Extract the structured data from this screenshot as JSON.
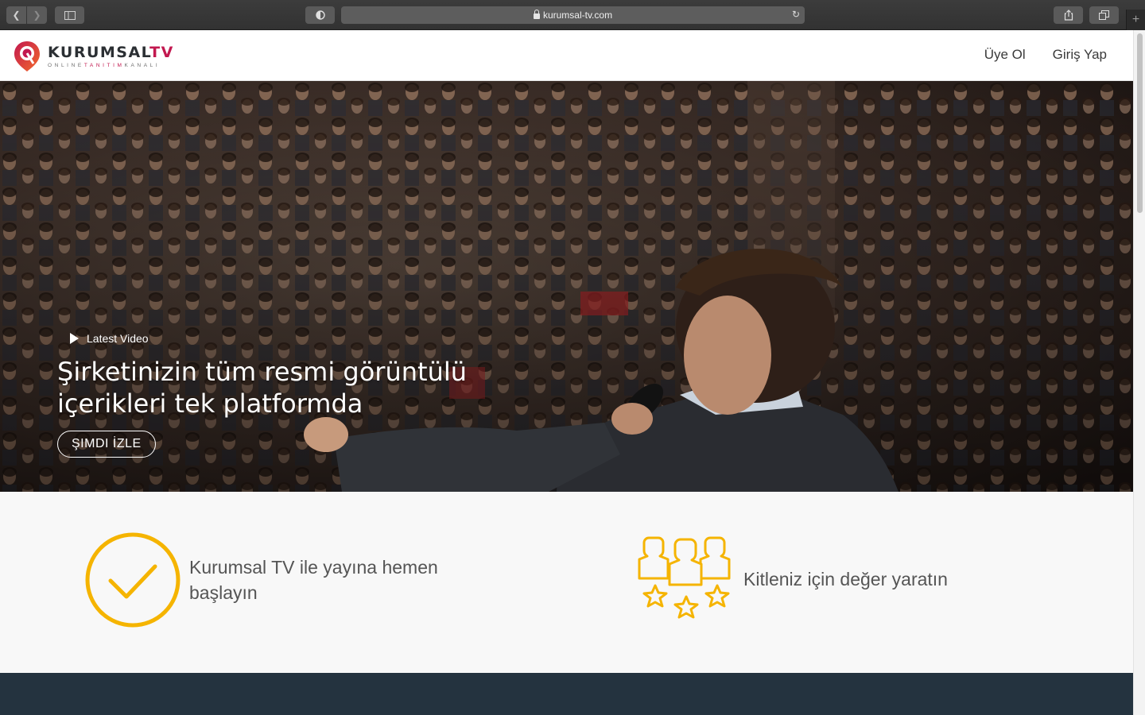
{
  "browser": {
    "url": "kurumsal-tv.com",
    "back_icon": "chevron-left-icon",
    "forward_icon": "chevron-right-icon"
  },
  "header": {
    "logo": {
      "word": "KURUMSAL",
      "word_accent": "TV",
      "tagline_a": "ONLINE",
      "tagline_b": "TANITIM",
      "tagline_c": "KANALI"
    },
    "nav": {
      "signup": "Üye Ol",
      "login": "Giriş Yap"
    }
  },
  "hero": {
    "eyebrow": "Latest Video",
    "title": "Şirketinizin tüm resmi görüntülü içerikleri tek platformda",
    "cta": "ŞIMDI İZLE"
  },
  "features": [
    {
      "icon": "checkmark-circle-icon",
      "text": "Kurumsal TV ile yayına hemen başlayın"
    },
    {
      "icon": "audience-stars-icon",
      "text": "Kitleniz için değer yaratın"
    }
  ],
  "colors": {
    "brand": "#c2184f",
    "accent": "#f5b400",
    "dark_section": "#24333f"
  }
}
